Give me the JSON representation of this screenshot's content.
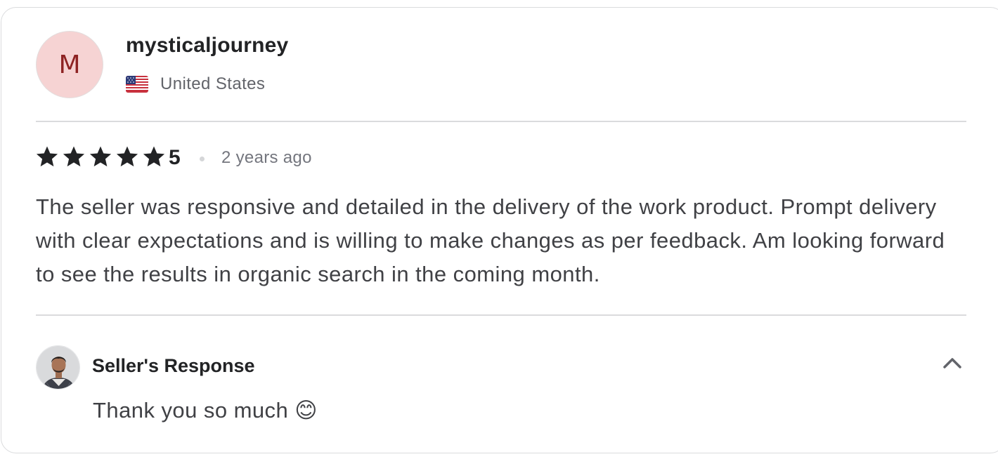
{
  "reviewer": {
    "avatar_initial": "M",
    "username": "mysticaljourney",
    "country": "United States",
    "flag_icon": "us-flag-icon"
  },
  "review": {
    "stars": 5,
    "rating_label": "5",
    "time_ago": "2 years ago",
    "text": "The seller was responsive and detailed in the delivery of the work product. Prompt delivery with clear expectations and is willing to make changes as per feedback. Am looking forward to see the results in organic search in the coming month."
  },
  "seller_response": {
    "title": "Seller's Response",
    "message": "Thank you so much",
    "emoji": "😊",
    "collapse_icon": "chevron-up-icon"
  },
  "colors": {
    "avatar_bg": "#f6d3d3",
    "avatar_text": "#8e2323",
    "star": "#222325",
    "divider": "#dadbdd"
  }
}
